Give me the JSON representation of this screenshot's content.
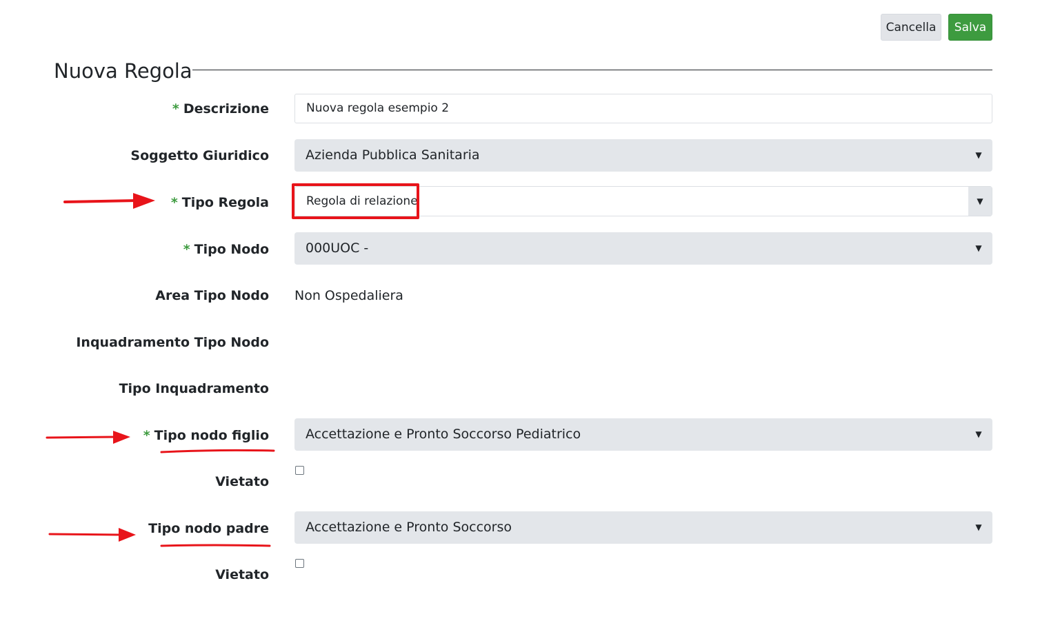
{
  "header": {
    "cancel_label": "Cancella",
    "save_label": "Salva",
    "title": "Nuova Regola"
  },
  "form": {
    "required_mark": "*",
    "descrizione": {
      "label": "Descrizione",
      "value": "Nuova regola esempio 2"
    },
    "soggetto_giuridico": {
      "label": "Soggetto Giuridico",
      "value": "Azienda Pubblica Sanitaria"
    },
    "tipo_regola": {
      "label": "Tipo Regola",
      "value": "Regola di relazione"
    },
    "tipo_nodo": {
      "label": "Tipo Nodo",
      "value": "000UOC -"
    },
    "area_tipo_nodo": {
      "label": "Area Tipo Nodo",
      "value": "Non Ospedaliera"
    },
    "inquadramento_tipo_nodo": {
      "label": "Inquadramento Tipo Nodo"
    },
    "tipo_inquadramento": {
      "label": "Tipo Inquadramento"
    },
    "tipo_nodo_figlio": {
      "label": "Tipo nodo figlio",
      "value": "Accettazione e Pronto Soccorso Pediatrico"
    },
    "vietato_figlio": {
      "label": "Vietato",
      "checked": false
    },
    "tipo_nodo_padre": {
      "label": "Tipo nodo padre",
      "value": "Accettazione e Pronto Soccorso"
    },
    "vietato_padre": {
      "label": "Vietato",
      "checked": false
    }
  },
  "icons": {
    "caret": "caret-down-icon"
  },
  "colors": {
    "save_button": "#3d9b3f",
    "required": "#3d9b3f",
    "annotation": "#e8141a"
  }
}
